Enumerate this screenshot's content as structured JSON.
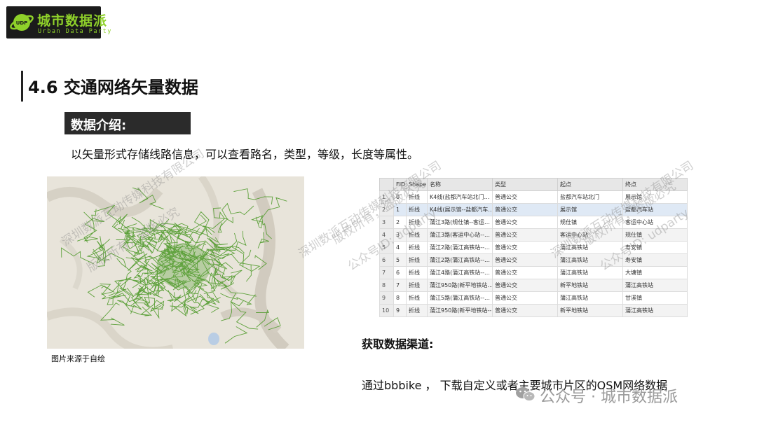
{
  "logo": {
    "title": "城市数据派",
    "subtitle": "Urban Data Party"
  },
  "slide": {
    "title": "4.6 交通网络矢量数据",
    "intro_label": "数据介绍:",
    "description": "以矢量形式存储线路信息，可以查看路名，类型，等级，长度等属性。",
    "image_caption": "图片来源于自绘",
    "get_title": "获取数据渠道:",
    "get_desc": "通过bbbike ， 下载自定义或者主要城市片区的OSM网络数据"
  },
  "table": {
    "headers": [
      "",
      "FID",
      "Shape",
      "名称",
      "类型",
      "起点",
      "终点"
    ],
    "rows": [
      [
        "1",
        "0",
        "折线",
        "K4线(盐都汽车站北门…",
        "普通公交",
        "盐都汽车站北门",
        "展示馆"
      ],
      [
        "2",
        "1",
        "折线",
        "K4线(展示馆--盐都汽车…",
        "普通公交",
        "展示馆",
        "盐都汽车站"
      ],
      [
        "3",
        "2",
        "折线",
        "蒲江3路(规仕镇--客运…",
        "普通公交",
        "规仕镇",
        "客运中心站"
      ],
      [
        "4",
        "3",
        "折线",
        "蒲江3路(客运中心站--…",
        "普通公交",
        "客运中心站",
        "规仕镇"
      ],
      [
        "5",
        "4",
        "折线",
        "蒲江2路(蒲江高铁站--…",
        "普通公交",
        "蒲江高铁站",
        "寿安镇"
      ],
      [
        "6",
        "5",
        "折线",
        "蒲江2路(蒲江高铁站--…",
        "普通公交",
        "蒲江高铁站",
        "寿安镇"
      ],
      [
        "7",
        "6",
        "折线",
        "蒲江4路(蒲江高铁站--…",
        "普通公交",
        "蒲江高铁站",
        "大塘镇"
      ],
      [
        "8",
        "7",
        "折线",
        "蒲江950路(新平地铁站…",
        "普通公交",
        "新平地铁站",
        "蒲江高铁站"
      ],
      [
        "9",
        "8",
        "折线",
        "蒲江5路(蒲江高铁站--…",
        "普通公交",
        "蒲江高铁站",
        "甘溪镇"
      ],
      [
        "10",
        "9",
        "折线",
        "蒲江950路(新平地铁站--…",
        "普通公交",
        "新平地铁站",
        "蒲江高铁站"
      ]
    ]
  },
  "watermarks": {
    "company": "深圳数派互动传媒科技有限公司",
    "rights": "版权所有，盗版必究",
    "account": "公众号ID: udparty"
  },
  "footer": {
    "account": "公众号 · 城市数据派"
  },
  "colors": {
    "route": "#4f9a2a",
    "logo_green": "#8fd12a",
    "dark": "#2b2b2b"
  },
  "icons": {
    "logo": "planet-ring-icon",
    "footer": "wechat-icon"
  }
}
